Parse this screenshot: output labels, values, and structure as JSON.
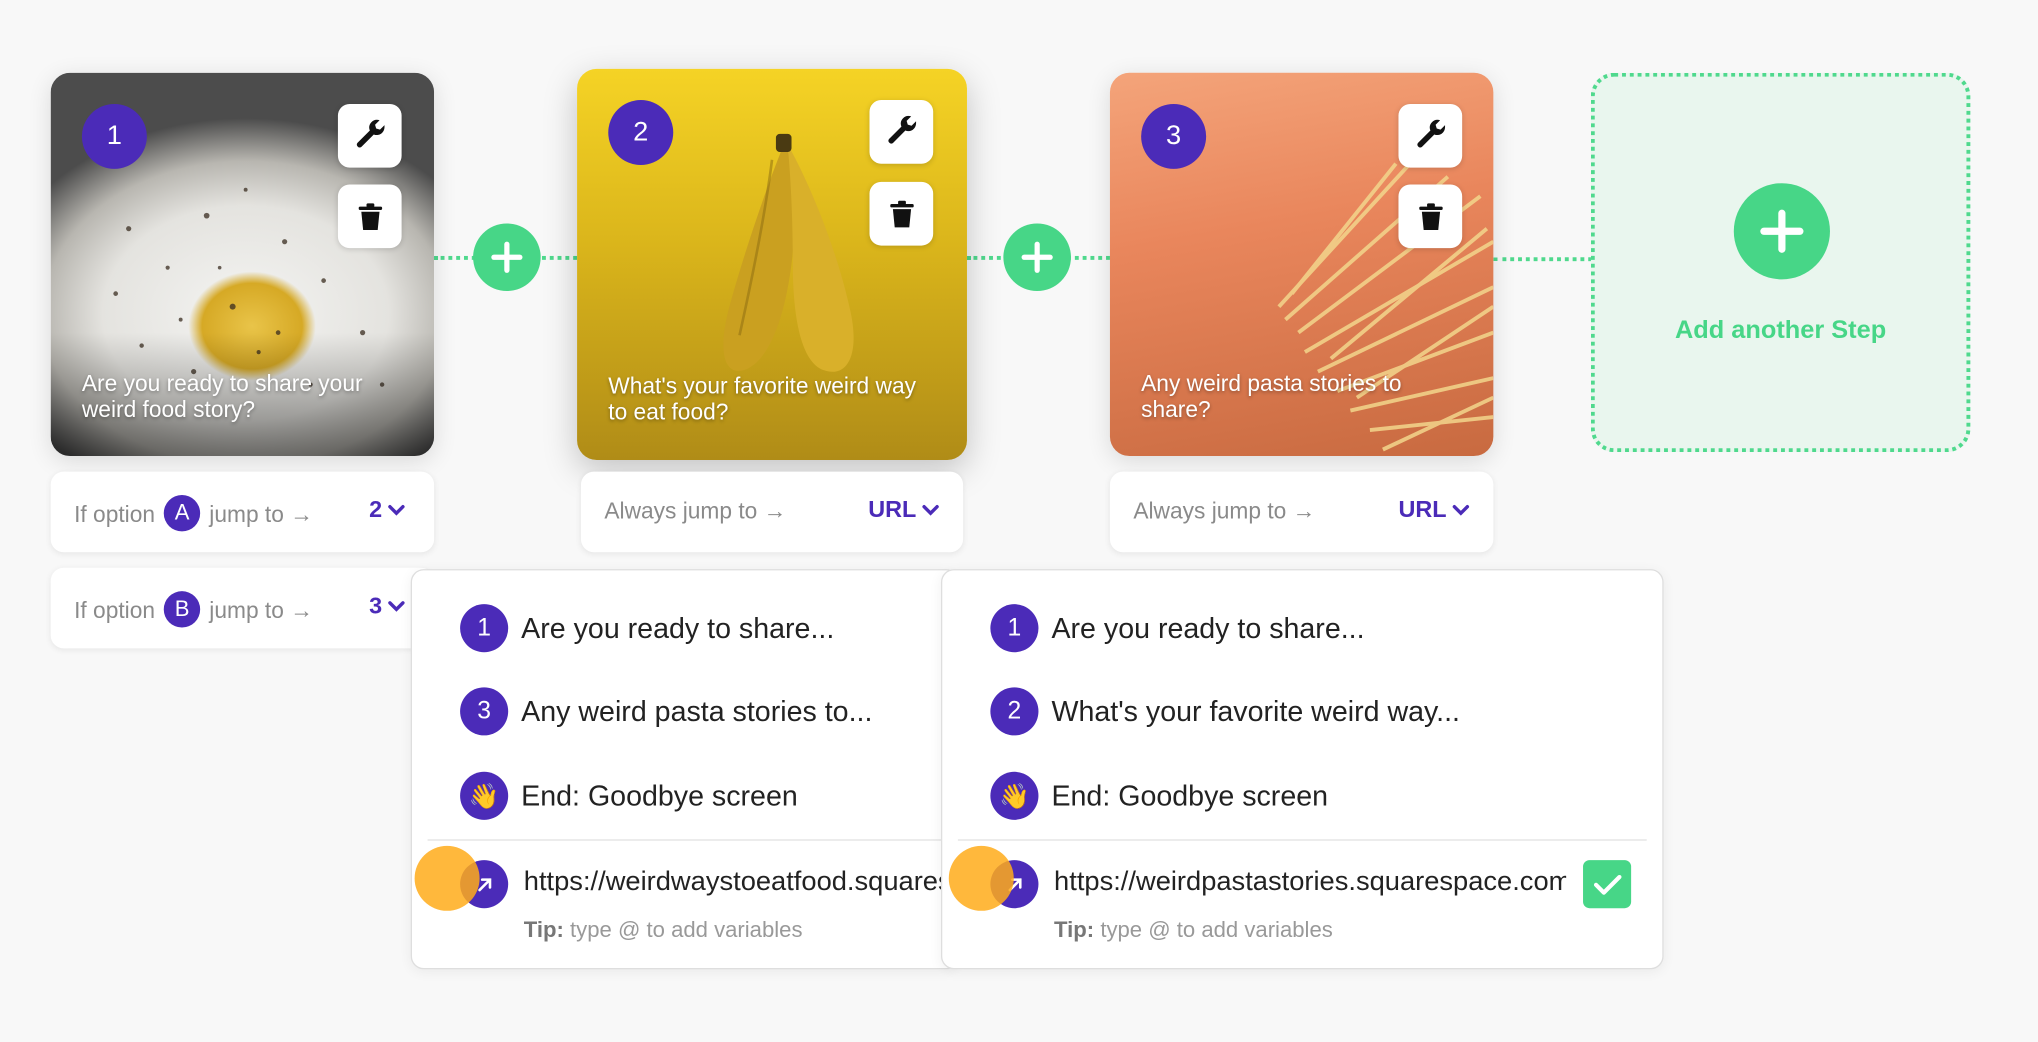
{
  "steps": [
    {
      "number": "1",
      "title": "Are you ready to share your weird food story?",
      "image": "fried-egg-photo"
    },
    {
      "number": "2",
      "title": "What's your favorite weird way to eat food?",
      "image": "banana-photo"
    },
    {
      "number": "3",
      "title": "Any weird pasta stories to share?",
      "image": "spaghetti-photo"
    }
  ],
  "add_step": {
    "label": "Add another Step"
  },
  "rules": {
    "step1_a": {
      "prefix": "If option",
      "option": "A",
      "suffix": "jump to →",
      "target": "2"
    },
    "step1_b": {
      "prefix": "If option",
      "option": "B",
      "suffix": "jump to →",
      "target": "3"
    },
    "step2": {
      "label": "Always jump to →",
      "target": "URL"
    },
    "step3": {
      "label": "Always jump to →",
      "target": "URL"
    }
  },
  "dropdown_step2": {
    "items": [
      {
        "badge": "1",
        "text": "Are you ready to share..."
      },
      {
        "badge": "3",
        "text": "Any weird pasta stories to..."
      },
      {
        "badge": "👋",
        "text": "End: Goodbye screen"
      }
    ],
    "url_value": "https://weirdwaystoeatfood.squarespace.com",
    "tip_label": "Tip:",
    "tip_text": "type @ to add variables"
  },
  "dropdown_step3": {
    "items": [
      {
        "badge": "1",
        "text": "Are you ready to share..."
      },
      {
        "badge": "2",
        "text": "What's your favorite weird way..."
      },
      {
        "badge": "👋",
        "text": "End: Goodbye screen"
      }
    ],
    "url_value": "https://weirdpastastories.squarespace.com",
    "tip_label": "Tip:",
    "tip_text": "type @ to add variables"
  },
  "colors": {
    "accent": "#4b2bb8",
    "green": "#47d687",
    "cursor": "#ffab1a"
  },
  "icons": [
    "wrench-icon",
    "trash-icon",
    "plus-icon",
    "chevron-down-icon",
    "external-link-icon",
    "check-icon",
    "wave-emoji"
  ]
}
